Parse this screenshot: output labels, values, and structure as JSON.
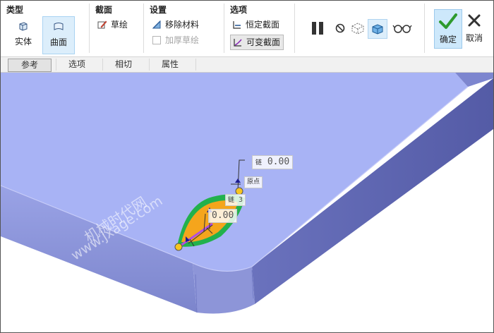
{
  "ribbon": {
    "type_group": {
      "title": "类型",
      "solid": "实体",
      "surface": "曲面"
    },
    "section_group": {
      "title": "截面",
      "sketch": "草绘"
    },
    "settings_group": {
      "title": "设置",
      "remove_material": "移除材料",
      "thicken_sketch": "加厚草绘"
    },
    "options_group": {
      "title": "选项",
      "constant_section": "恒定截面",
      "variable_section": "可变截面"
    },
    "actions": {
      "ok": "确定",
      "cancel": "取消"
    }
  },
  "tabs": [
    "参考",
    "选项",
    "相切",
    "属性"
  ],
  "viewport": {
    "dim_top": "0.00",
    "dim_top_prefix": "链",
    "origin_label": "原点",
    "chain_label": "链",
    "chain_value": "3",
    "dim_mid": "0.00",
    "watermark_cn": "机械时代网",
    "watermark_url": "www.jxage.com"
  },
  "colors": {
    "face": "#a8b3f5",
    "side": "#8a93d6",
    "accent_select": "#dceefb",
    "ok_green": "#2e9a2e",
    "sketch_orange": "#f5a51c",
    "sketch_green": "#22b14c"
  }
}
